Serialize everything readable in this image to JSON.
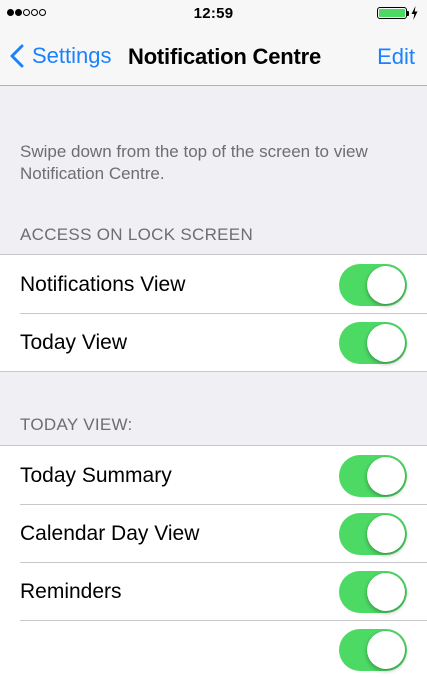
{
  "status_bar": {
    "signal_bars": 2,
    "signal_total": 5,
    "time": "12:59",
    "battery_level": 1.0
  },
  "nav": {
    "back_label": "Settings",
    "title": "Notification Centre",
    "edit_label": "Edit"
  },
  "description": "Swipe down from the top of the screen to view Notification Centre.",
  "lock_screen": {
    "header": "ACCESS ON LOCK SCREEN",
    "rows": [
      {
        "label": "Notifications View",
        "on": true
      },
      {
        "label": "Today View",
        "on": true
      }
    ]
  },
  "today_view": {
    "header": "TODAY VIEW:",
    "rows": [
      {
        "label": "Today Summary",
        "on": true
      },
      {
        "label": "Calendar Day View",
        "on": true
      },
      {
        "label": "Reminders",
        "on": true
      },
      {
        "label": "",
        "on": true
      }
    ]
  },
  "colors": {
    "accent": "#1a82fb",
    "toggle_on": "#4cd964",
    "background": "#efeff4"
  }
}
